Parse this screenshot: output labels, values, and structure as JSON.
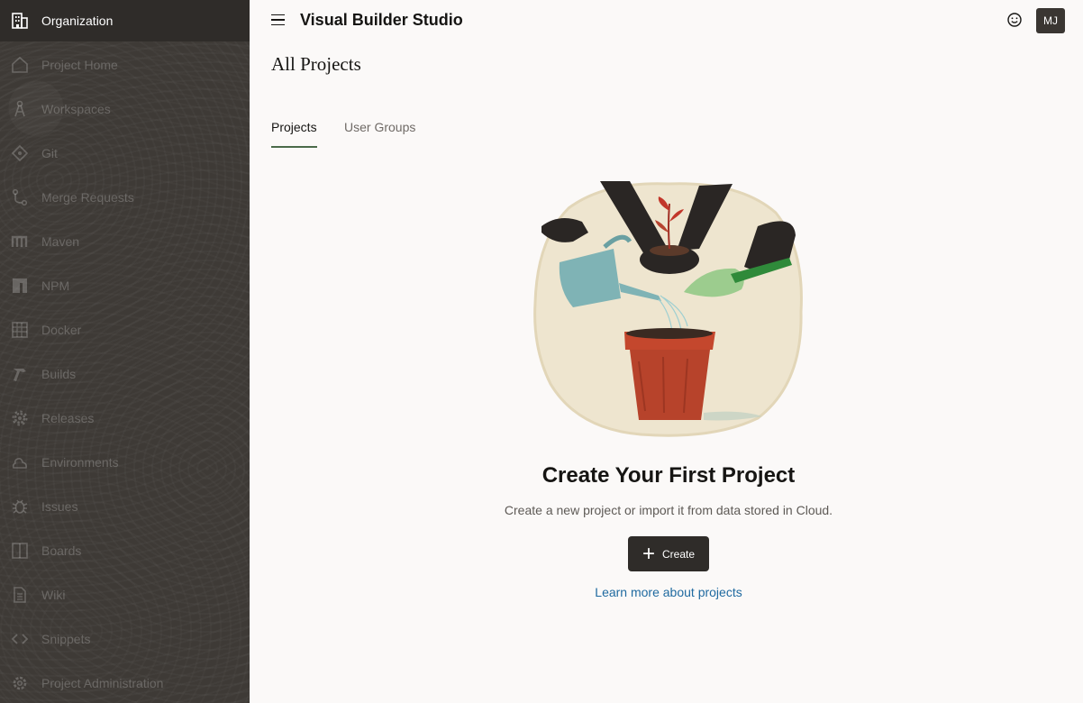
{
  "sidebar": {
    "items": [
      {
        "label": "Organization",
        "icon": "building-icon",
        "active": true
      },
      {
        "label": "Project Home",
        "icon": "home-icon"
      },
      {
        "label": "Workspaces",
        "icon": "compass-icon"
      },
      {
        "label": "Git",
        "icon": "git-icon"
      },
      {
        "label": "Merge Requests",
        "icon": "merge-icon"
      },
      {
        "label": "Maven",
        "icon": "maven-icon"
      },
      {
        "label": "NPM",
        "icon": "npm-icon"
      },
      {
        "label": "Docker",
        "icon": "docker-icon"
      },
      {
        "label": "Builds",
        "icon": "hammer-icon"
      },
      {
        "label": "Releases",
        "icon": "gear-icon"
      },
      {
        "label": "Environments",
        "icon": "cloud-icon"
      },
      {
        "label": "Issues",
        "icon": "bug-icon"
      },
      {
        "label": "Boards",
        "icon": "board-icon"
      },
      {
        "label": "Wiki",
        "icon": "document-icon"
      },
      {
        "label": "Snippets",
        "icon": "code-icon"
      },
      {
        "label": "Project Administration",
        "icon": "settings-icon"
      }
    ]
  },
  "header": {
    "app_title": "Visual Builder Studio",
    "avatar_initials": "MJ"
  },
  "main": {
    "page_title": "All Projects",
    "tabs": [
      {
        "label": "Projects",
        "active": true
      },
      {
        "label": "User Groups",
        "active": false
      }
    ],
    "empty_state": {
      "title": "Create Your First Project",
      "description": "Create a new project or import it from data stored in Cloud.",
      "create_label": "Create",
      "learn_more_label": "Learn more about projects"
    }
  },
  "colors": {
    "sidebar_bg": "#3e3a36",
    "active_tab_underline": "#4b6b4a",
    "link": "#1f6aa0",
    "button_bg": "#2f2c29"
  }
}
